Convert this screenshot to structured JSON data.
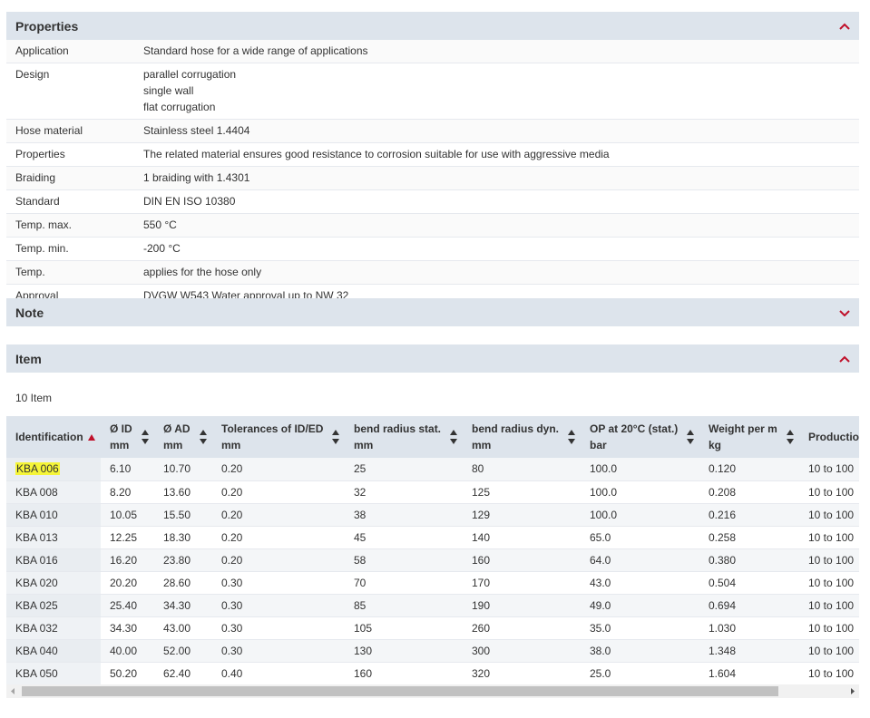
{
  "properties": {
    "title": "Properties",
    "rows": [
      {
        "key": "Application",
        "lines": [
          "Standard hose for a wide range of applications"
        ]
      },
      {
        "key": "Design",
        "lines": [
          "parallel corrugation",
          "single wall",
          "flat corrugation"
        ]
      },
      {
        "key": "Hose material",
        "lines": [
          "Stainless steel 1.4404"
        ]
      },
      {
        "key": "Properties",
        "lines": [
          "The related material ensures good resistance to corrosion suitable for use with aggressive media"
        ]
      },
      {
        "key": "Braiding",
        "lines": [
          "1 braiding with 1.4301"
        ]
      },
      {
        "key": "Standard",
        "lines": [
          "DIN EN ISO 10380"
        ]
      },
      {
        "key": "Temp. max.",
        "lines": [
          "550 °C"
        ]
      },
      {
        "key": "Temp. min.",
        "lines": [
          "-200 °C"
        ]
      },
      {
        "key": "Temp.",
        "lines": [
          "applies for the hose only"
        ]
      },
      {
        "key": "Approval",
        "lines": [
          "DVGW W543 Water approval up to NW 32"
        ]
      }
    ]
  },
  "note": {
    "title": "Note"
  },
  "item": {
    "title": "Item",
    "count": "10 Item",
    "columns": [
      {
        "line1": "Identification",
        "line2": ""
      },
      {
        "line1": "Ø ID",
        "line2": "mm"
      },
      {
        "line1": "Ø AD",
        "line2": "mm"
      },
      {
        "line1": "Tolerances of ID/ED",
        "line2": "mm"
      },
      {
        "line1": "bend radius stat.",
        "line2": "mm"
      },
      {
        "line1": "bend radius dyn.",
        "line2": "mm"
      },
      {
        "line1": "OP at 20°C (stat.)",
        "line2": "bar"
      },
      {
        "line1": "Weight per m",
        "line2": "kg"
      },
      {
        "line1": "Productio",
        "line2": ""
      }
    ],
    "rows": [
      [
        "KBA 006",
        "6.10",
        "10.70",
        "0.20",
        "25",
        "80",
        "100.0",
        "0.120",
        "10 to 100"
      ],
      [
        "KBA 008",
        "8.20",
        "13.60",
        "0.20",
        "32",
        "125",
        "100.0",
        "0.208",
        "10 to 100"
      ],
      [
        "KBA 010",
        "10.05",
        "15.50",
        "0.20",
        "38",
        "129",
        "100.0",
        "0.216",
        "10 to 100"
      ],
      [
        "KBA 013",
        "12.25",
        "18.30",
        "0.20",
        "45",
        "140",
        "65.0",
        "0.258",
        "10 to 100"
      ],
      [
        "KBA 016",
        "16.20",
        "23.80",
        "0.20",
        "58",
        "160",
        "64.0",
        "0.380",
        "10 to 100"
      ],
      [
        "KBA 020",
        "20.20",
        "28.60",
        "0.30",
        "70",
        "170",
        "43.0",
        "0.504",
        "10 to 100"
      ],
      [
        "KBA 025",
        "25.40",
        "34.30",
        "0.30",
        "85",
        "190",
        "49.0",
        "0.694",
        "10 to 100"
      ],
      [
        "KBA 032",
        "34.30",
        "43.00",
        "0.30",
        "105",
        "260",
        "35.0",
        "1.030",
        "10 to 100"
      ],
      [
        "KBA 040",
        "40.00",
        "52.00",
        "0.30",
        "130",
        "300",
        "38.0",
        "1.348",
        "10 to 100"
      ],
      [
        "KBA 050",
        "50.20",
        "62.40",
        "0.40",
        "160",
        "320",
        "25.0",
        "1.604",
        "10 to 100"
      ]
    ],
    "highlighted_id": "KBA 006"
  },
  "colors": {
    "header_bg": "#dde4ec",
    "accent": "#c0102a",
    "highlight": "#f5f538"
  },
  "icons": {
    "expand_open": "chevron-up-icon",
    "expand_closed": "chevron-down-icon",
    "sort": "sort-arrows-icon",
    "sort_active": "sort-asc-icon"
  }
}
